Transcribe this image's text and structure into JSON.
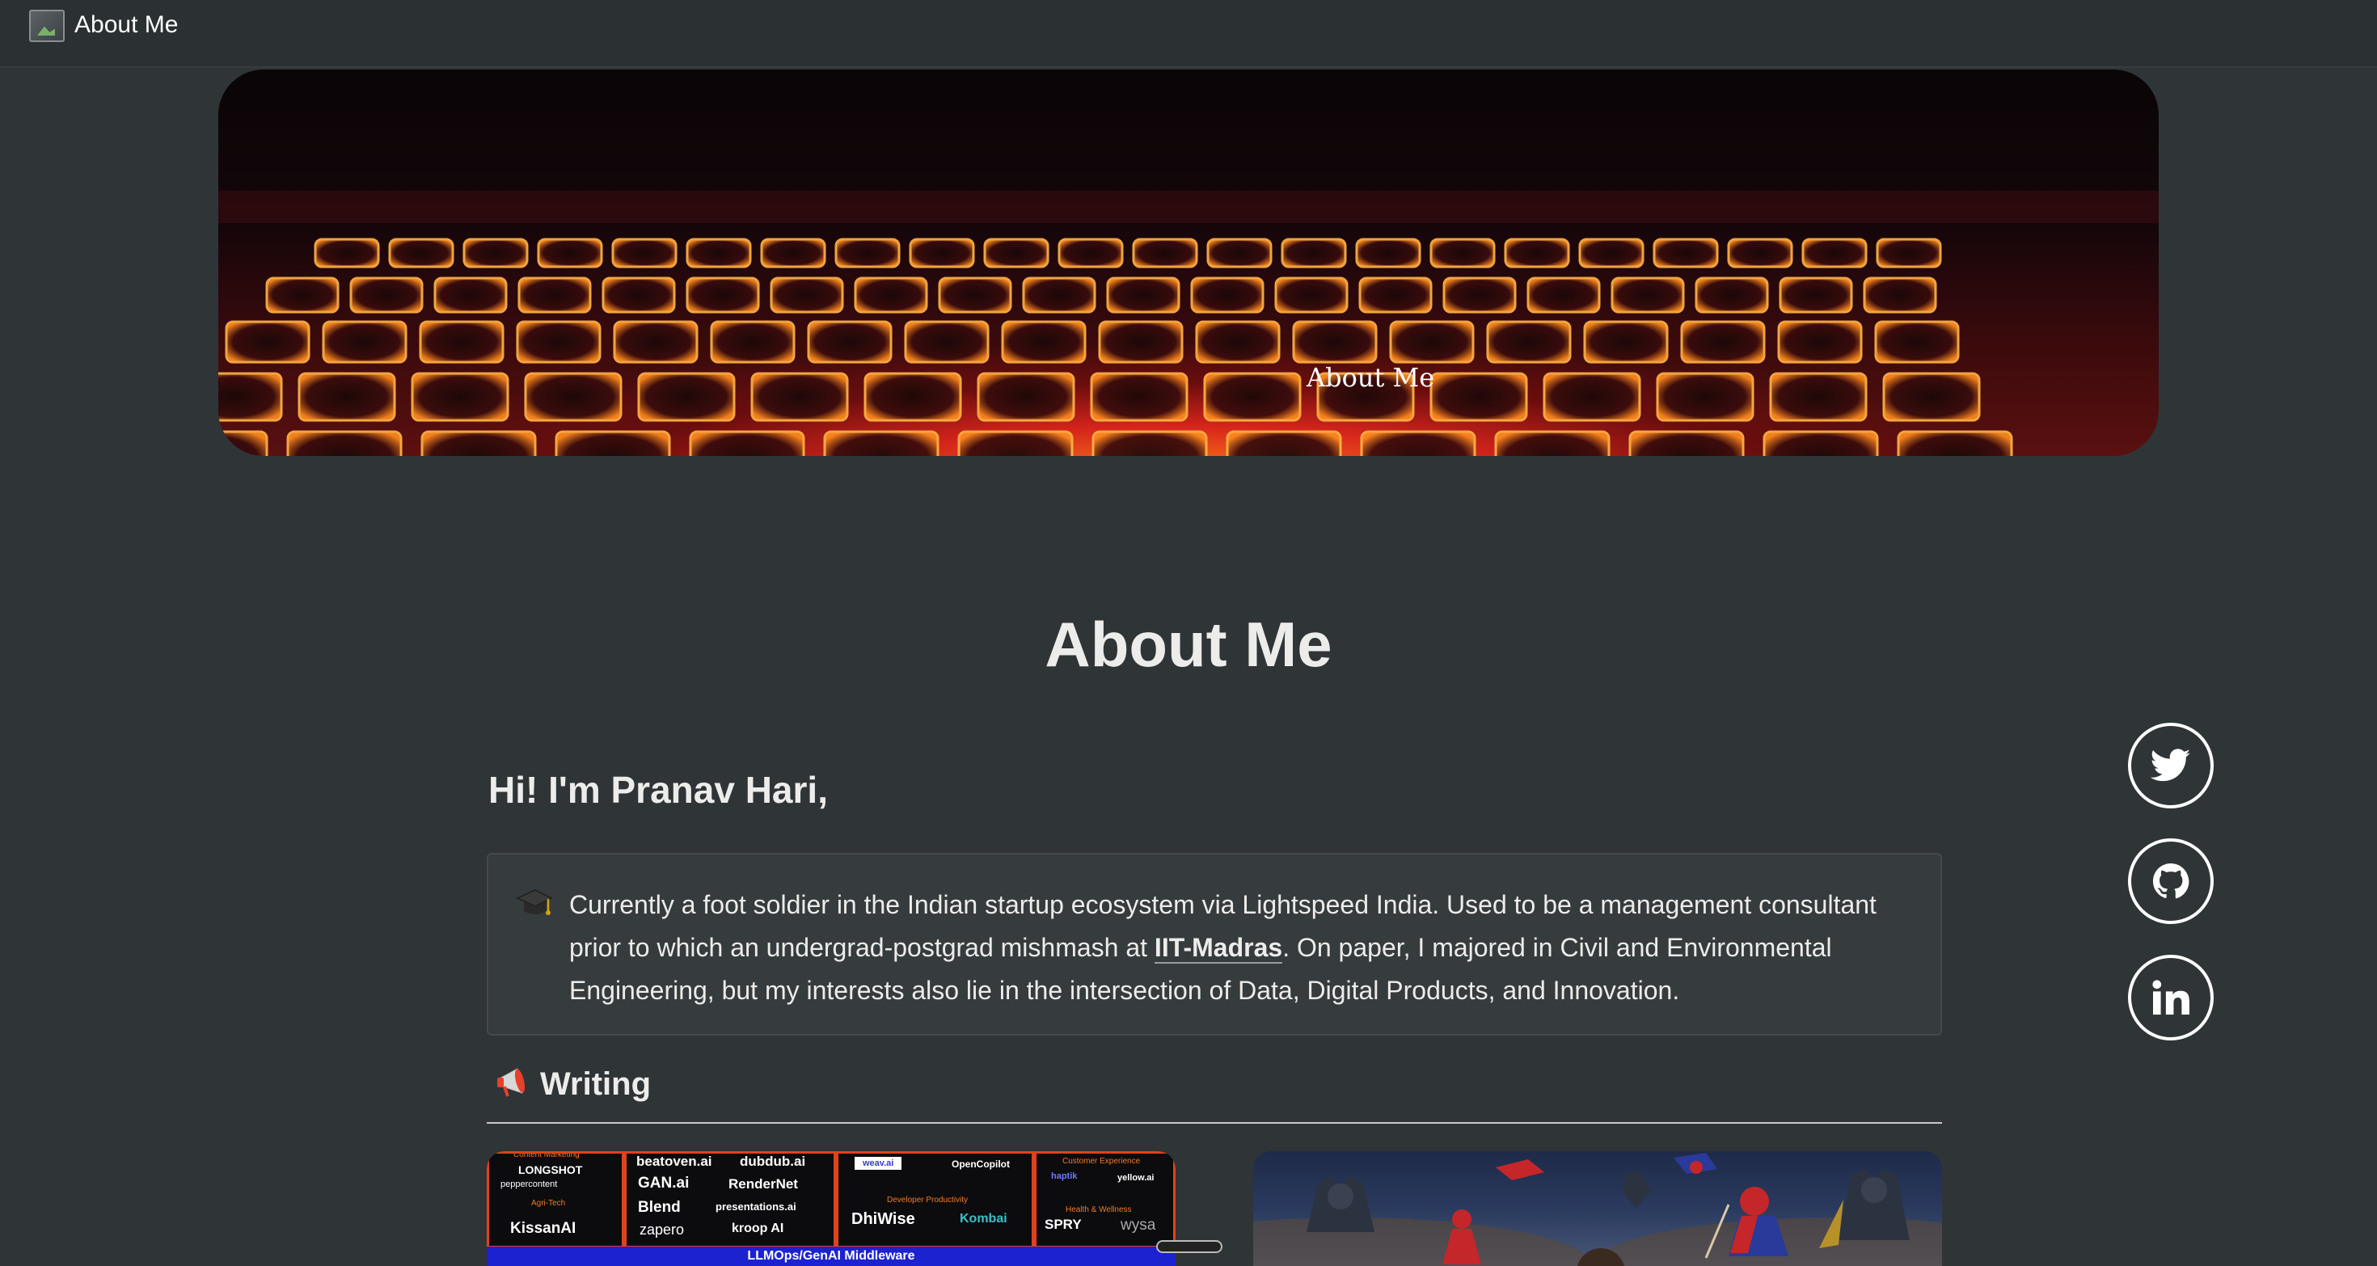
{
  "tab": {
    "title": "About Me",
    "favicon_icon": "broken-image-icon"
  },
  "cover": {
    "image": "red-backlit-keyboard",
    "alt_text": "About    Me"
  },
  "page": {
    "title": "About Me",
    "intro_heading": "Hi! I'm Pranav Hari,",
    "callout": {
      "icon": "graduation-cap-icon",
      "text_before_link": "Currently a foot soldier in the Indian startup ecosystem via Lightspeed India. Used to be a management consultant prior to which an undergrad-postgrad mishmash at ",
      "link_text": "IIT-Madras",
      "text_after_link": ". On paper, I majored in Civil and Environmental Engineering, but my interests also lie in the intersection of Data, Digital Products, and Innovation."
    },
    "writing_section": {
      "icon": "megaphone-icon",
      "heading": "Writing"
    }
  },
  "cards": {
    "card1": {
      "categories": [
        "Content Marketing",
        "Agri-Tech",
        "Developer Productivity",
        "Customer Experience",
        "Health & Wellness"
      ],
      "logos": [
        "LONGSHOT",
        "peppercontent",
        "KissanAI",
        "beatoven.ai",
        "dubdub.ai",
        "GAN.ai",
        "RenderNet",
        "Blend",
        "presentations.ai",
        "zapero",
        "kroop AI",
        "weav.ai",
        "OpenCopilot",
        "DhiWise",
        "Kombai",
        "haptik",
        "yellow.ai",
        "SPRY",
        "wysa"
      ],
      "footer_bar": "LLMOps/GenAI Middleware"
    },
    "card2": {
      "image": "superheroes-illustration"
    }
  },
  "social": {
    "twitter_icon": "twitter-icon",
    "github_icon": "github-icon",
    "linkedin_icon": "linkedin-icon"
  },
  "colors": {
    "background": "#2f3437",
    "text": "#ececea",
    "callout_bg": "#363b3e",
    "accent_orange": "#e0421c",
    "accent_blue": "#1c22d0"
  }
}
